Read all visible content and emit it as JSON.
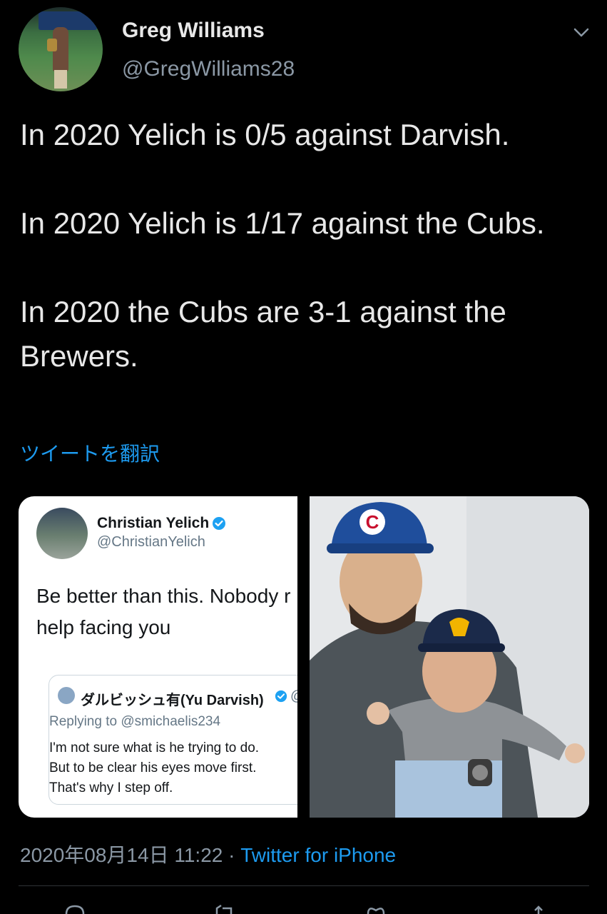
{
  "tweet": {
    "author_name": "Greg Williams",
    "author_handle": "@GregWilliams28",
    "text": "In 2020 Yelich is 0/5 against Darvish.\n\nIn 2020 Yelich is 1/17 against the Cubs.\n\nIn 2020 the Cubs are 3-1 against the Brewers.",
    "translate_label": "ツイートを翻訳",
    "timestamp": "2020年08月14日 11:22",
    "separator": " · ",
    "source": "Twitter for iPhone"
  },
  "media": {
    "screenshot": {
      "author_name": "Christian Yelich",
      "author_handle": "@ChristianYelich",
      "text": "Be better than this. Nobody r\nhelp facing you",
      "quoted": {
        "author_name": "ダルビッシュ有(Yu Darvish)",
        "author_at_partial": "@",
        "replying_to": "Replying to @smichaelis234",
        "text": "I'm not sure what is he trying to do.\nBut to be clear his eyes move first.\nThat's why I step off."
      }
    },
    "photo": {
      "cap_letter": "C"
    }
  },
  "colors": {
    "background": "#000000",
    "link": "#1d9bf0",
    "secondary_text": "#8b98a5",
    "verified": "#1da1f2"
  },
  "icons": [
    "chevron-down-icon",
    "verified-badge-icon",
    "reply-icon",
    "retweet-icon",
    "like-icon",
    "share-icon"
  ]
}
